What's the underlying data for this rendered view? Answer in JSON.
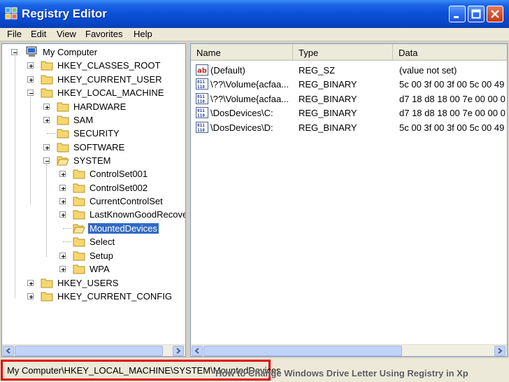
{
  "window": {
    "title": "Registry Editor",
    "icon": "registry-icon"
  },
  "menu": [
    "File",
    "Edit",
    "View",
    "Favorites",
    "Help"
  ],
  "tree": {
    "root": "My Computer",
    "nodes": {
      "hkcr": "HKEY_CLASSES_ROOT",
      "hkcu": "HKEY_CURRENT_USER",
      "hklm": "HKEY_LOCAL_MACHINE",
      "hardware": "HARDWARE",
      "sam": "SAM",
      "security": "SECURITY",
      "software": "SOFTWARE",
      "system": "SYSTEM",
      "cs001": "ControlSet001",
      "cs002": "ControlSet002",
      "ccs": "CurrentControlSet",
      "lkg": "LastKnownGoodRecove",
      "mounted": "MountedDevices",
      "select": "Select",
      "setup": "Setup",
      "wpa": "WPA",
      "hku": "HKEY_USERS",
      "hkcc": "HKEY_CURRENT_CONFIG"
    },
    "selected": "MountedDevices"
  },
  "list": {
    "columns": [
      "Name",
      "Type",
      "Data"
    ],
    "rows": [
      {
        "icon": "string-value-icon",
        "name": "(Default)",
        "type": "REG_SZ",
        "data": "(value not set)"
      },
      {
        "icon": "binary-value-icon",
        "name": "\\??\\Volume{acfaa...",
        "type": "REG_BINARY",
        "data": "5c 00 3f 00 3f 00 5c 00 49"
      },
      {
        "icon": "binary-value-icon",
        "name": "\\??\\Volume{acfaa...",
        "type": "REG_BINARY",
        "data": "d7 18 d8 18 00 7e 00 00 0"
      },
      {
        "icon": "binary-value-icon",
        "name": "\\DosDevices\\C:",
        "type": "REG_BINARY",
        "data": "d7 18 d8 18 00 7e 00 00 0"
      },
      {
        "icon": "binary-value-icon",
        "name": "\\DosDevices\\D:",
        "type": "REG_BINARY",
        "data": "5c 00 3f 00 3f 00 5c 00 49"
      }
    ]
  },
  "status": {
    "path": "My Computer\\HKEY_LOCAL_MACHINE\\SYSTEM\\MountedDevices"
  },
  "watermark": "How to Change Windows Drive Letter Using Registry in Xp",
  "colors": {
    "titlebar": "#0a50d8",
    "selection": "#316ac5",
    "highlight_border": "#e00000",
    "folder": "#f5d76e"
  }
}
